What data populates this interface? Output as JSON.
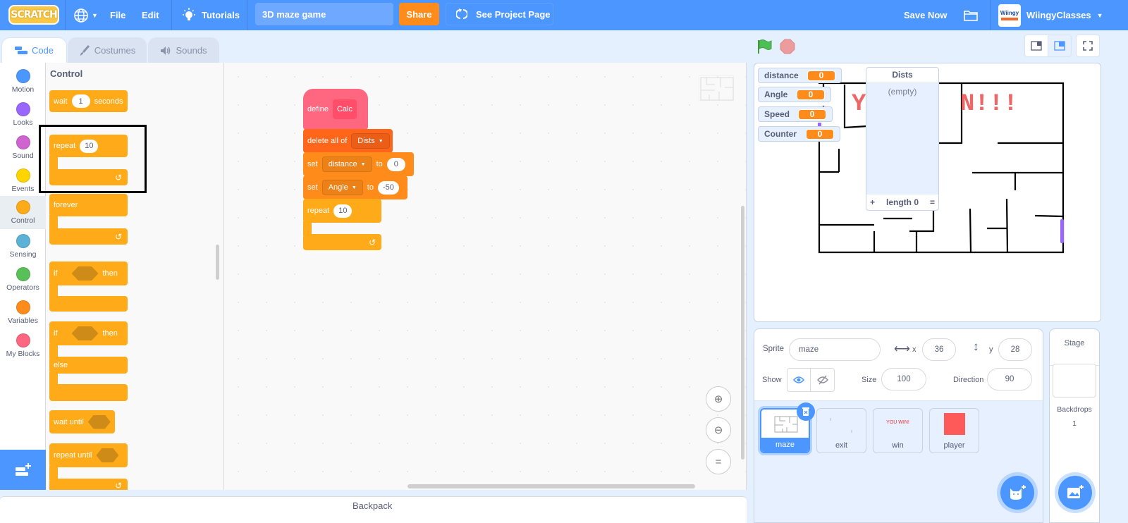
{
  "menubar": {
    "logo": "SCRATCH",
    "file": "File",
    "edit": "Edit",
    "tutorials": "Tutorials",
    "project_title": "3D maze game",
    "share": "Share",
    "see_project_page": "See Project Page",
    "save_now": "Save Now",
    "username": "WiingyClasses",
    "avatar_text": "Wiingy"
  },
  "tabs": [
    {
      "label": "Code",
      "icon": "code-icon",
      "active": true
    },
    {
      "label": "Costumes",
      "icon": "brush-icon",
      "active": false
    },
    {
      "label": "Sounds",
      "icon": "speaker-icon",
      "active": false
    }
  ],
  "categories": [
    {
      "label": "Motion",
      "color": "#4c97ff"
    },
    {
      "label": "Looks",
      "color": "#9966ff"
    },
    {
      "label": "Sound",
      "color": "#cf63cf"
    },
    {
      "label": "Events",
      "color": "#ffd500"
    },
    {
      "label": "Control",
      "color": "#ffab19",
      "selected": true
    },
    {
      "label": "Sensing",
      "color": "#5cb1d6"
    },
    {
      "label": "Operators",
      "color": "#59c059"
    },
    {
      "label": "Variables",
      "color": "#ff8c1a"
    },
    {
      "label": "My Blocks",
      "color": "#ff6680"
    }
  ],
  "palette": {
    "title": "Control",
    "wait": {
      "label": "wait",
      "value": "1",
      "suffix": "seconds"
    },
    "repeat": {
      "label": "repeat",
      "value": "10"
    },
    "forever": "forever",
    "if_then": {
      "if": "if",
      "then": "then"
    },
    "if_else": {
      "if": "if",
      "then": "then",
      "else": "else"
    },
    "wait_until": "wait until",
    "repeat_until": "repeat until"
  },
  "script": {
    "define": {
      "label": "define",
      "name": "Calc"
    },
    "delete_all": {
      "label": "delete all of",
      "list": "Dists"
    },
    "set1": {
      "label": "set",
      "var": "distance",
      "to": "to",
      "value": "0"
    },
    "set2": {
      "label": "set",
      "var": "Angle",
      "to": "to",
      "value": "-50"
    },
    "repeat": {
      "label": "repeat",
      "value": "10"
    }
  },
  "backpack": "Backpack",
  "stage": {
    "monitors": [
      {
        "name": "distance",
        "value": "0"
      },
      {
        "name": "Angle",
        "value": "0"
      },
      {
        "name": "Speed",
        "value": "0"
      },
      {
        "name": "Counter",
        "value": "0"
      }
    ],
    "list_monitor": {
      "title": "Dists",
      "empty": "(empty)",
      "add": "+",
      "length": "length 0",
      "resize": "="
    },
    "win_text": "N!!!"
  },
  "sprite_info": {
    "sprite_label": "Sprite",
    "sprite_name": "maze",
    "x_label": "x",
    "x": "36",
    "y_label": "y",
    "y": "28",
    "show_label": "Show",
    "size_label": "Size",
    "size": "100",
    "direction_label": "Direction",
    "direction": "90"
  },
  "sprites": [
    {
      "name": "maze",
      "selected": true
    },
    {
      "name": "exit"
    },
    {
      "name": "win",
      "thumb_text": "YOU WIN!"
    },
    {
      "name": "player"
    }
  ],
  "stage_pane": {
    "title": "Stage",
    "backdrops_label": "Backdrops",
    "backdrops_count": "1"
  }
}
